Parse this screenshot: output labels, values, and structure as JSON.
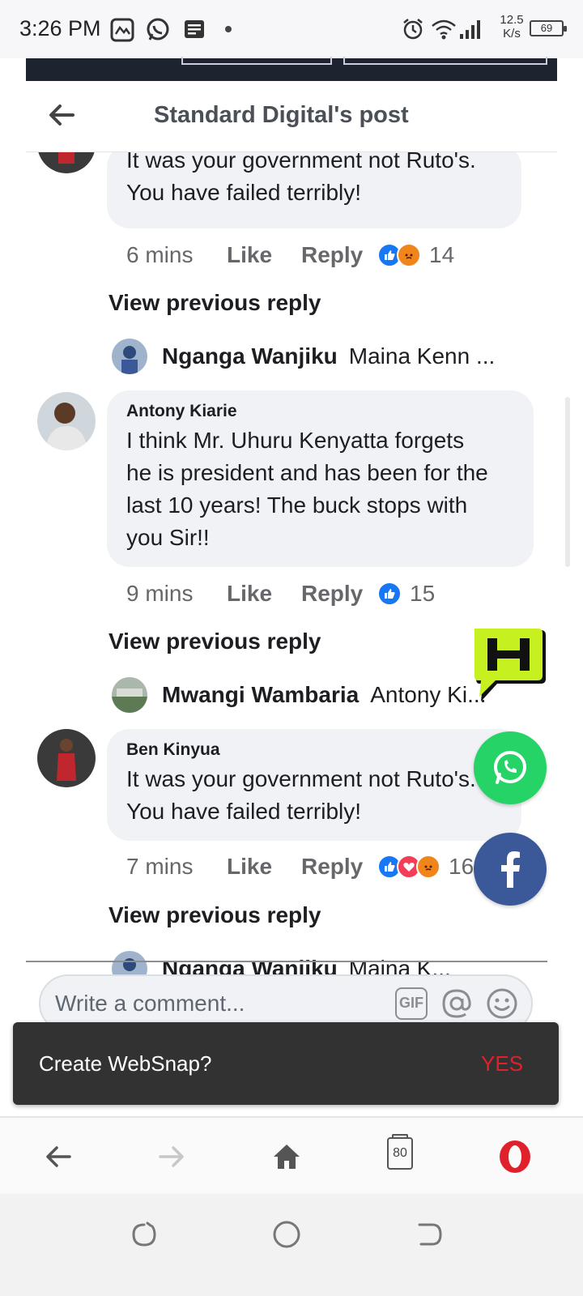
{
  "status_bar": {
    "time": "3:26 PM",
    "net_speed_value": "12.5",
    "net_speed_unit": "K/s",
    "battery": "69",
    "icons": [
      "gallery-icon",
      "whatsapp-icon",
      "notes-icon",
      "dot-icon",
      "alarm-icon",
      "wifi-icon",
      "signal-icon"
    ]
  },
  "header": {
    "title": "Standard Digital's post",
    "back_icon": "arrow-left-icon"
  },
  "comments": [
    {
      "author": "",
      "text_lines": [
        "It was your government not Ruto's.",
        "You have failed terribly!"
      ],
      "time": "6 mins",
      "like_label": "Like",
      "reply_label": "Reply",
      "reactions": [
        "like",
        "angry"
      ],
      "reaction_count": "14",
      "view_previous": "View previous reply",
      "reply_preview": {
        "name": "Nganga Wanjiku",
        "snippet": "Maina Kenn ..."
      }
    },
    {
      "author": "Antony Kiarie",
      "text_lines": [
        "I think Mr. Uhuru Kenyatta forgets",
        "he is president and has been for the",
        "last 10 years! The buck stops with",
        "you Sir!!"
      ],
      "time": "9 mins",
      "like_label": "Like",
      "reply_label": "Reply",
      "reactions": [
        "like"
      ],
      "reaction_count": "15",
      "view_previous": "View previous reply",
      "reply_preview": {
        "name": "Mwangi Wambaria",
        "snippet": "Antony Ki..."
      }
    },
    {
      "author": "Ben Kinyua",
      "text_lines": [
        "It was your government not Ruto's.",
        "You have failed terribly!"
      ],
      "time": "7 mins",
      "like_label": "Like",
      "reply_label": "Reply",
      "reactions": [
        "like",
        "love",
        "angry"
      ],
      "reaction_count": "16",
      "view_previous": "View previous reply",
      "reply_preview": {
        "name": "Nganga Wanjiku",
        "snippet": "Maina K..."
      }
    }
  ],
  "composer": {
    "placeholder": "Write a comment...",
    "gif_label": "GIF",
    "icons": [
      "gif-icon",
      "mention-icon",
      "emoji-icon"
    ]
  },
  "snackbar": {
    "text": "Create WebSnap?",
    "action": "YES"
  },
  "browser_bar": {
    "tabs_count": "80",
    "icons": [
      "back-icon",
      "forward-icon",
      "home-icon",
      "tabs-icon",
      "opera-icon"
    ]
  },
  "colors": {
    "accent_like": "#1877f2",
    "whatsapp": "#25d366",
    "facebook": "#3b5998",
    "snackbar_action": "#e0202a",
    "opera_red": "#e0202a"
  }
}
